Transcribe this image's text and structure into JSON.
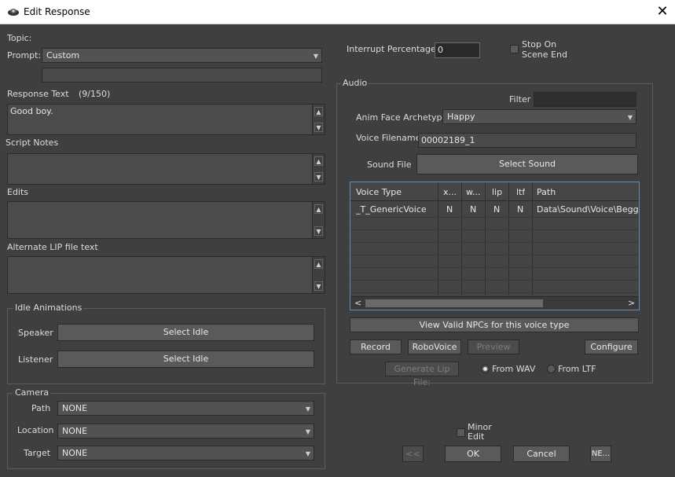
{
  "window": {
    "title": "Edit Response",
    "close": "✕"
  },
  "topic": {
    "label": "Topic:"
  },
  "prompt": {
    "label": "Prompt:",
    "value": "Custom"
  },
  "response_text": {
    "label": "Response Text",
    "count": "(9/150)",
    "value": "Good boy."
  },
  "script_notes": {
    "label": "Script Notes"
  },
  "edits": {
    "label": "Edits"
  },
  "alt_lip": {
    "label": "Alternate LIP file text"
  },
  "idle": {
    "group": "Idle Animations",
    "speaker_label": "Speaker",
    "listener_label": "Listener",
    "select_idle": "Select Idle"
  },
  "camera": {
    "group": "Camera",
    "path_label": "Path",
    "location_label": "Location",
    "target_label": "Target",
    "path_value": "NONE",
    "location_value": "NONE",
    "target_value": "NONE"
  },
  "interrupt": {
    "label": "Interrupt Percentage",
    "value": "0"
  },
  "stop_on_scene_end": {
    "line1": "Stop On",
    "line2": "Scene End"
  },
  "audio": {
    "group": "Audio",
    "filter_label": "Filter",
    "anim_face_label": "Anim Face Archetype",
    "anim_face_value": "Happy",
    "voice_filename_label": "Voice Filename",
    "voice_filename_value": "00002189_1",
    "sound_file_label": "Sound File",
    "select_sound": "Select Sound",
    "columns": [
      "Voice Type",
      "x...",
      "w...",
      "lip",
      "ltf",
      "Path"
    ],
    "rows": [
      [
        "_T_GenericVoice",
        "N",
        "N",
        "N",
        "N",
        "Data\\Sound\\Voice\\Beggar_"
      ]
    ],
    "view_valid": "View Valid NPCs for this voice type",
    "record": "Record",
    "robovoice": "RoboVoice",
    "preview": "Preview",
    "configure": "Configure",
    "generate_lip": "Generate Lip File:",
    "from_wav": "From WAV",
    "from_ltf": "From LTF"
  },
  "footer": {
    "minor_line1": "Minor",
    "minor_line2": "Edit",
    "prev": "<<",
    "ok": "OK",
    "cancel": "Cancel",
    "next": "NE..."
  }
}
